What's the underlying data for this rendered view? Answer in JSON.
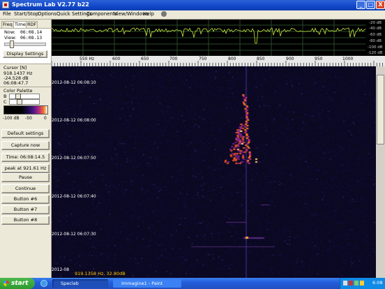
{
  "window": {
    "title": "Spectrum Lab V2.77 b22",
    "minimize": "_",
    "maximize": "□",
    "close": "X"
  },
  "menu": [
    "File",
    "Start/Stop",
    "Options",
    "Quick Settings",
    "Components",
    "View/Windows",
    "Help"
  ],
  "left_panel": {
    "tabs": [
      "Freq",
      "Time",
      "RDF"
    ],
    "active_tab": "Time",
    "now_label": "Now:",
    "now_value": "06:08.14",
    "view_label": "View:",
    "view_value": "06:08.13",
    "display_settings": "Display Settings",
    "cursor_header": "Cursor [N]",
    "cursor_freq": "918.1437 Hz",
    "cursor_level": "-24.528 dB",
    "cursor_time": "06:08:47.7",
    "color_palette_header": "Color Palette",
    "b_label": "B",
    "c_label": "C",
    "palette_scale": [
      "-100 dB",
      "-50",
      "0"
    ],
    "default_settings": "Default settings",
    "capture_now": "Capture now",
    "time_readout": "Time: 06:08:14.5",
    "peak_readout": "peak at 921.61 Hz",
    "pause": "Pause",
    "continue": "Continue",
    "button6": "Button #6",
    "button7": "Button #7",
    "button8": "Button #8"
  },
  "spectrum": {
    "db_labels": [
      "-20 dB",
      "-40 dB",
      "-60 dB",
      "-80 dB",
      "-100 dB",
      "-120 dB"
    ],
    "trace_color": "#c8e63c"
  },
  "freq_scale": {
    "unit": "Hz",
    "ticks": [
      "550",
      "600",
      "650",
      "700",
      "750",
      "800",
      "850",
      "900",
      "950",
      "1000"
    ],
    "first_label": "550 Hz"
  },
  "waterfall": {
    "time_labels": [
      "2012-08-12 06:08:10",
      "2012-08-12 06:08:00",
      "2012-08-12 06:07:50",
      "2012-08-12 06:07:40",
      "2012-08-12 06:07:30",
      "2012-08"
    ],
    "cursor_readout": "919.1358 Hz, 32.80dB"
  },
  "taskbar": {
    "start": "start",
    "items": [
      "Speclab",
      "Immagine1 - Paint"
    ],
    "clock": "6:08"
  }
}
